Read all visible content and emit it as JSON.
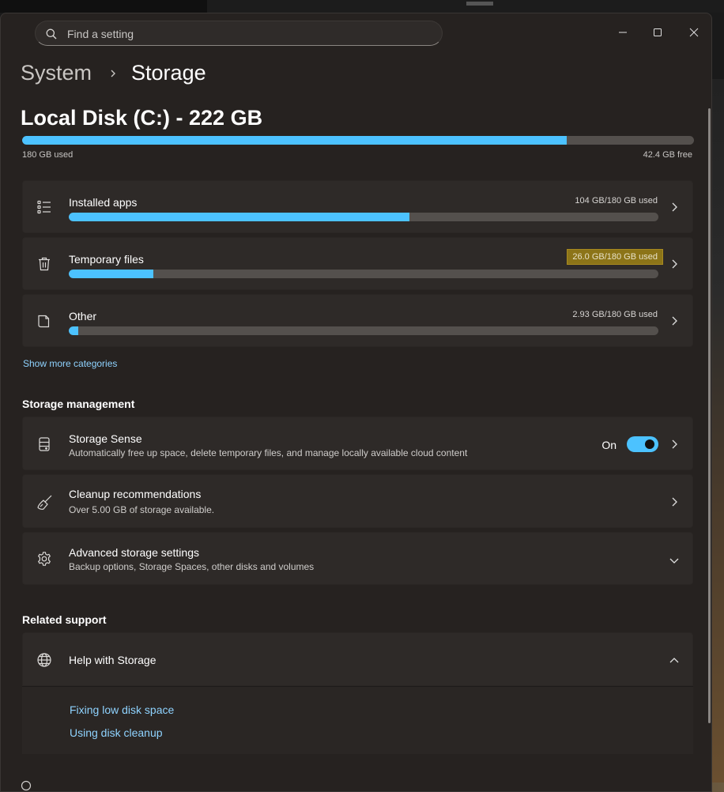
{
  "search": {
    "placeholder": "Find a setting",
    "icon": "search-icon"
  },
  "window_controls": [
    "minimize-icon",
    "maximize-icon",
    "close-icon"
  ],
  "breadcrumb": {
    "parent": "System",
    "current": "Storage"
  },
  "disk": {
    "title": "Local Disk (C:) - 222 GB",
    "used_label": "180 GB used",
    "free_label": "42.4 GB free",
    "used_fraction": 0.81
  },
  "categories": [
    {
      "label": "Installed apps",
      "value": "104 GB/180 GB used",
      "fraction": 0.578,
      "icon": "list-icon"
    },
    {
      "label": "Temporary files",
      "value": "26.0 GB/180 GB used",
      "fraction": 0.144,
      "icon": "trash-icon"
    },
    {
      "label": "Other",
      "value": "2.93 GB/180 GB used",
      "fraction": 0.016,
      "icon": "document-icon"
    }
  ],
  "show_more": "Show more categories",
  "storage_management": {
    "heading": "Storage management",
    "items": [
      {
        "title": "Storage Sense",
        "subtitle": "Automatically free up space, delete temporary files, and manage locally available cloud content",
        "toggle_label": "On",
        "icon": "drive-icon"
      },
      {
        "title": "Cleanup recommendations",
        "subtitle": "Over 5.00 GB of storage available.",
        "icon": "broom-icon"
      },
      {
        "title": "Advanced storage settings",
        "subtitle": "Backup options, Storage Spaces, other disks and volumes",
        "icon": "gear-icon"
      }
    ]
  },
  "related_support": {
    "heading": "Related support",
    "help_title": "Help with Storage",
    "icon": "globe-icon",
    "links": [
      "Fixing low disk space",
      "Using disk cleanup"
    ]
  },
  "colors": {
    "accent": "#4cc2ff",
    "highlight": "#8c7418",
    "link": "#8fd3ff"
  }
}
